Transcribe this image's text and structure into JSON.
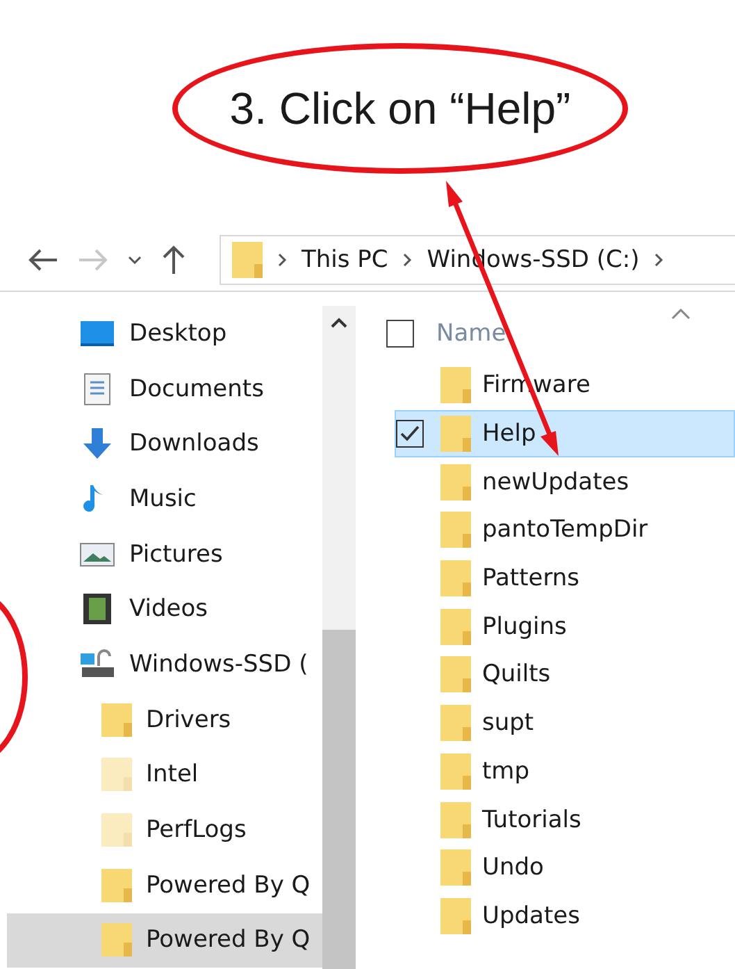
{
  "annotation": {
    "callout": "3. Click on “Help”"
  },
  "toolbar": {
    "buttons": [
      {
        "kind": "back",
        "disabled": false
      },
      {
        "kind": "forward",
        "disabled": true
      },
      {
        "kind": "recent",
        "disabled": false
      },
      {
        "kind": "up",
        "disabled": false
      }
    ]
  },
  "address_bar": {
    "segments": [
      "This PC",
      "Windows-SSD (C:)"
    ]
  },
  "sidebar": {
    "items": [
      {
        "label": "Desktop",
        "kind": "desktop",
        "selected": false
      },
      {
        "label": "Documents",
        "kind": "documents",
        "selected": false
      },
      {
        "label": "Downloads",
        "kind": "downloads",
        "selected": false
      },
      {
        "label": "Music",
        "kind": "music",
        "selected": false
      },
      {
        "label": "Pictures",
        "kind": "pictures",
        "selected": false
      },
      {
        "label": "Videos",
        "kind": "videos",
        "selected": false
      },
      {
        "label": "Windows-SSD (",
        "kind": "drive",
        "selected": false,
        "children": [
          {
            "label": "Drivers",
            "kind": "folder",
            "hidden": false,
            "selected": false
          },
          {
            "label": "Intel",
            "kind": "folder",
            "hidden": true,
            "selected": false
          },
          {
            "label": "PerfLogs",
            "kind": "folder",
            "hidden": true,
            "selected": false
          },
          {
            "label": "Powered By Q",
            "kind": "folder",
            "hidden": false,
            "selected": false
          },
          {
            "label": "Powered By Q",
            "kind": "folder",
            "hidden": false,
            "selected": true
          }
        ]
      }
    ]
  },
  "file_list": {
    "column": "Name",
    "select_all": {
      "checked": false
    },
    "rows": [
      {
        "name": "Firmware",
        "selected": false,
        "checked": false
      },
      {
        "name": "Help",
        "selected": true,
        "checked": true
      },
      {
        "name": "newUpdates",
        "selected": false,
        "checked": false
      },
      {
        "name": "pantoTempDir",
        "selected": false,
        "checked": false
      },
      {
        "name": "Patterns",
        "selected": false,
        "checked": false
      },
      {
        "name": "Plugins",
        "selected": false,
        "checked": false
      },
      {
        "name": "Quilts",
        "selected": false,
        "checked": false
      },
      {
        "name": "supt",
        "selected": false,
        "checked": false
      },
      {
        "name": "tmp",
        "selected": false,
        "checked": false
      },
      {
        "name": "Tutorials",
        "selected": false,
        "checked": false
      },
      {
        "name": "Undo",
        "selected": false,
        "checked": false
      },
      {
        "name": "Updates",
        "selected": false,
        "checked": false
      }
    ]
  }
}
